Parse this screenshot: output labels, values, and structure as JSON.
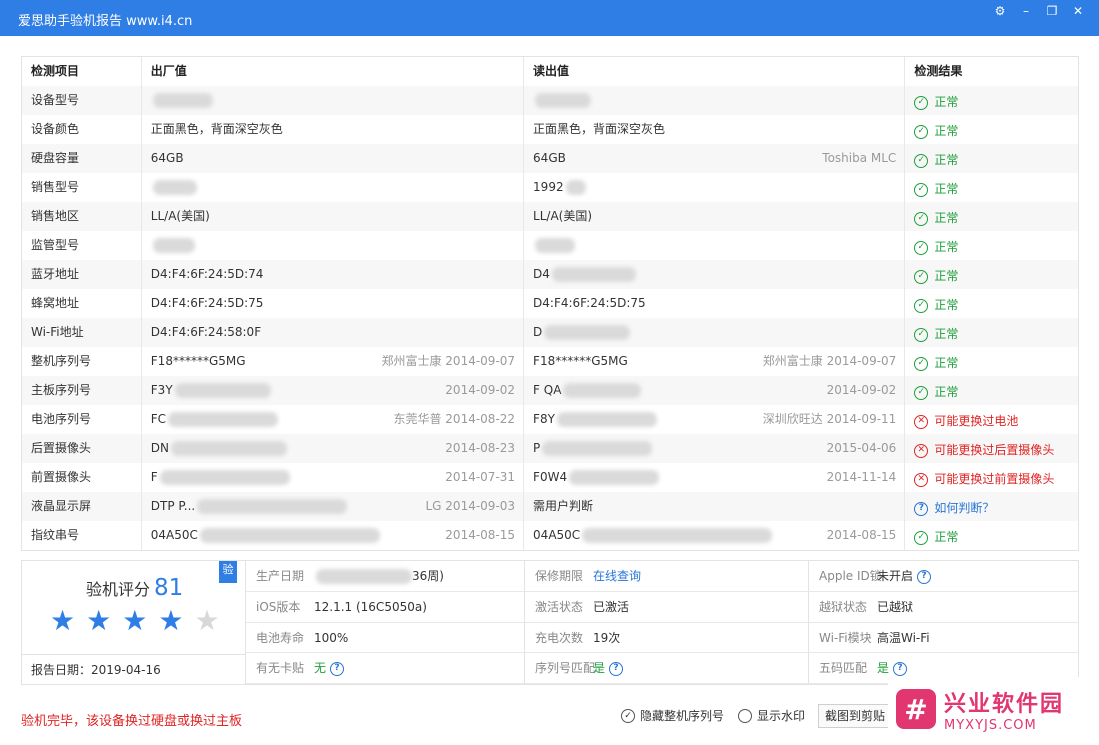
{
  "window": {
    "title": "爱思助手验机报告 www.i4.cn",
    "buttons": [
      "⚙",
      "–",
      "❐",
      "✕"
    ]
  },
  "table": {
    "headers": [
      "检测项目",
      "出厂值",
      "读出值",
      "检测结果"
    ],
    "rows": [
      {
        "item": "设备型号",
        "factory": "",
        "factory_note": "",
        "read": "",
        "read_note": "",
        "result": "正常",
        "status": "ok",
        "f_blur": 60,
        "r_blur": 56
      },
      {
        "item": "设备颜色",
        "factory": "正面黑色，背面深空灰色",
        "factory_note": "",
        "read": "正面黑色，背面深空灰色",
        "read_note": "",
        "result": "正常",
        "status": "ok"
      },
      {
        "item": "硬盘容量",
        "factory": "64GB",
        "factory_note": "",
        "read": "64GB",
        "read_note": "Toshiba MLC",
        "result": "正常",
        "status": "ok"
      },
      {
        "item": "销售型号",
        "factory": "",
        "factory_note": "",
        "read": "1992",
        "read_note": "",
        "result": "正常",
        "status": "ok",
        "f_blur": 44,
        "r_blur": 20
      },
      {
        "item": "销售地区",
        "factory": "LL/A(美国)",
        "factory_note": "",
        "read": "LL/A(美国)",
        "read_note": "",
        "result": "正常",
        "status": "ok"
      },
      {
        "item": "监管型号",
        "factory": "",
        "factory_note": "",
        "read": "",
        "read_note": "",
        "result": "正常",
        "status": "ok",
        "f_blur": 42,
        "r_blur": 40
      },
      {
        "item": "蓝牙地址",
        "factory": "D4:F4:6F:24:5D:74",
        "factory_note": "",
        "read": "D4",
        "read_note": "",
        "result": "正常",
        "status": "ok",
        "r_blur": 84
      },
      {
        "item": "蜂窝地址",
        "factory": "D4:F4:6F:24:5D:75",
        "factory_note": "",
        "read": "D4:F4:6F:24:5D:75",
        "read_note": "",
        "result": "正常",
        "status": "ok"
      },
      {
        "item": "Wi-Fi地址",
        "factory": "D4:F4:6F:24:58:0F",
        "factory_note": "",
        "read": "D",
        "read_note": "",
        "result": "正常",
        "status": "ok",
        "r_blur": 86
      },
      {
        "item": "整机序列号",
        "factory": "F18******G5MG",
        "factory_note": "郑州富士康 2014-09-07",
        "read": "F18******G5MG",
        "read_note": "郑州富士康 2014-09-07",
        "result": "正常",
        "status": "ok"
      },
      {
        "item": "主板序列号",
        "factory": "F3Y",
        "factory_note": "2014-09-02",
        "read": "F QA",
        "read_note": "2014-09-02",
        "result": "正常",
        "status": "ok",
        "f_blur": 96,
        "r_blur": 78
      },
      {
        "item": "电池序列号",
        "factory": "FC",
        "factory_note": "东莞华普 2014-08-22",
        "read": "F8Y",
        "read_note": "深圳欣旺达 2014-09-11",
        "result": "可能更换过电池",
        "status": "bad",
        "f_blur": 110,
        "r_blur": 100
      },
      {
        "item": "后置摄像头",
        "factory": "DN",
        "factory_note": "2014-08-23",
        "read": "P",
        "read_note": "2015-04-06",
        "result": "可能更换过后置摄像头",
        "status": "bad",
        "f_blur": 116,
        "r_blur": 110
      },
      {
        "item": "前置摄像头",
        "factory": "F",
        "factory_note": "2014-07-31",
        "read": "F0W4",
        "read_note": "2014-11-14",
        "result": "可能更换过前置摄像头",
        "status": "bad",
        "f_blur": 130,
        "r_blur": 90
      },
      {
        "item": "液晶显示屏",
        "factory": "DTP P...",
        "factory_note": "LG 2014-09-03",
        "read": "需用户判断",
        "read_note": "",
        "result": "如何判断？",
        "status": "ask",
        "f_blur": 150
      },
      {
        "item": "指纹串号",
        "factory": "04A50C",
        "factory_note": "2014-08-15",
        "read": "04A50C",
        "read_note": "2014-08-15",
        "result": "正常",
        "status": "ok",
        "f_blur": 180,
        "r_blur": 190
      }
    ]
  },
  "summary": {
    "score_label": "验机评分",
    "score": "81",
    "badge": "验",
    "stars_filled": 4,
    "stars_total": 5,
    "report_date": "报告日期：2019-04-16",
    "cells": [
      {
        "k": "生产日期",
        "v": "36周)",
        "style": "",
        "blur": 96
      },
      {
        "k": "保修期限",
        "v": "在线查询",
        "style": "link"
      },
      {
        "k": "Apple ID锁",
        "v": "未开启",
        "style": "",
        "help": true
      },
      {
        "k": "iOS版本",
        "v": "12.1.1 (16C5050a)",
        "style": ""
      },
      {
        "k": "激活状态",
        "v": "已激活",
        "style": ""
      },
      {
        "k": "越狱状态",
        "v": "已越狱",
        "style": ""
      },
      {
        "k": "电池寿命",
        "v": "100%",
        "style": ""
      },
      {
        "k": "充电次数",
        "v": "19次",
        "style": ""
      },
      {
        "k": "Wi-Fi模块",
        "v": "高温Wi-Fi",
        "style": ""
      },
      {
        "k": "有无卡贴",
        "v": "无",
        "style": "green",
        "help": true
      },
      {
        "k": "序列号匹配",
        "v": "是",
        "style": "green",
        "help": true
      },
      {
        "k": "五码匹配",
        "v": "是",
        "style": "green",
        "help": true
      }
    ]
  },
  "footer": {
    "message": "验机完毕，该设备换过硬盘或换过主板",
    "hide_serial_label": "隐藏整机序列号",
    "hide_serial_checked": true,
    "watermark_label": "显示水印",
    "watermark_checked": false,
    "copy_button": "截图到剪贴"
  },
  "site_watermark": {
    "logo": "#",
    "cn": "兴业软件园",
    "en": "MYXYJS.COM"
  }
}
